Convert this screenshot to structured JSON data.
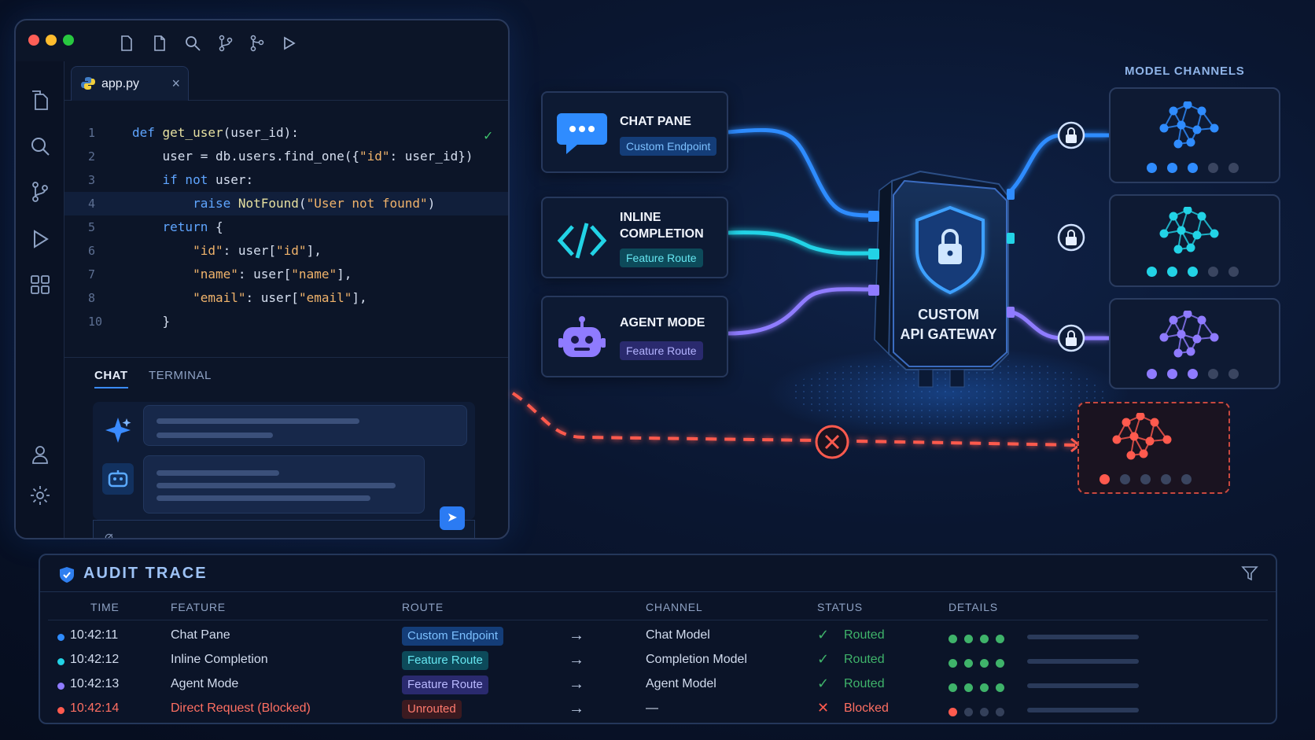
{
  "editor": {
    "tab": {
      "file_name": "app.py"
    },
    "lines": [
      {
        "num": "1",
        "parts": [
          [
            "k",
            "def "
          ],
          [
            "f",
            "get_user"
          ],
          [
            "n",
            "(user_id):"
          ]
        ]
      },
      {
        "num": "2",
        "parts": [
          [
            "n",
            "    user = db.users.find_one({"
          ],
          [
            "s",
            "\"id\""
          ],
          [
            "n",
            ": user_id})"
          ]
        ]
      },
      {
        "num": "3",
        "parts": [
          [
            "n",
            "    "
          ],
          [
            "k",
            "if not "
          ],
          [
            "n",
            "user:"
          ]
        ]
      },
      {
        "num": "4",
        "parts": [
          [
            "n",
            "        "
          ],
          [
            "k",
            "raise "
          ],
          [
            "f",
            "NotFound"
          ],
          [
            "n",
            "("
          ],
          [
            "s",
            "\"User not found\""
          ],
          [
            "n",
            ")"
          ]
        ]
      },
      {
        "num": "5",
        "parts": [
          [
            "n",
            "    "
          ],
          [
            "k",
            "return "
          ],
          [
            "n",
            "{"
          ]
        ]
      },
      {
        "num": "6",
        "parts": [
          [
            "n",
            "        "
          ],
          [
            "s",
            "\"id\""
          ],
          [
            "n",
            ": user["
          ],
          [
            "s",
            "\"id\""
          ],
          [
            "n",
            "],"
          ]
        ]
      },
      {
        "num": "7",
        "parts": [
          [
            "n",
            "        "
          ],
          [
            "s",
            "\"name\""
          ],
          [
            "n",
            ": user["
          ],
          [
            "s",
            "\"name\""
          ],
          [
            "n",
            "],"
          ]
        ]
      },
      {
        "num": "8",
        "parts": [
          [
            "n",
            "        "
          ],
          [
            "s",
            "\"email\""
          ],
          [
            "n",
            ": user["
          ],
          [
            "s",
            "\"email\""
          ],
          [
            "n",
            "],"
          ]
        ]
      },
      {
        "num": "10",
        "parts": [
          [
            "n",
            "    }"
          ]
        ]
      }
    ]
  },
  "panel": {
    "tabs": [
      {
        "label": "CHAT",
        "active": true
      },
      {
        "label": "TERMINAL",
        "active": false
      }
    ]
  },
  "features": [
    {
      "title": "CHAT PANE",
      "badge": "Custom Endpoint",
      "icon": "chat-bubble-icon",
      "color": "#2f8cff"
    },
    {
      "title": "INLINE\nCOMPLETION",
      "badge": "Feature Route",
      "icon": "code-brackets-icon",
      "color": "#22d3e6"
    },
    {
      "title": "AGENT MODE",
      "badge": "Feature Route",
      "icon": "robot-icon",
      "color": "#8f7bff"
    }
  ],
  "gateway": {
    "label_line1": "CUSTOM",
    "label_line2": "API GATEWAY"
  },
  "channels": {
    "title": "MODEL CHANNELS",
    "colors": [
      "#2f8cff",
      "#22d3e6",
      "#8f7bff",
      "#ff5a4e"
    ]
  },
  "audit": {
    "title": "AUDIT TRACE",
    "columns": [
      "TIME",
      "FEATURE",
      "ROUTE",
      "CHANNEL",
      "STATUS",
      "DETAILS"
    ],
    "rows": [
      {
        "time": "10:42:11",
        "feature": "Chat Pane",
        "route": "Custom Endpoint",
        "channel": "Chat Model",
        "status": "Routed",
        "bullet": "#2f8cff",
        "active_dots": 4
      },
      {
        "time": "10:42:12",
        "feature": "Inline Completion",
        "route": "Feature Route",
        "channel": "Completion Model",
        "status": "Routed",
        "bullet": "#22d3e6",
        "active_dots": 4
      },
      {
        "time": "10:42:13",
        "feature": "Agent Mode",
        "route": "Feature Route",
        "channel": "Agent Model",
        "status": "Routed",
        "bullet": "#8f7bff",
        "active_dots": 4
      },
      {
        "time": "10:42:14",
        "feature": "Direct Request (Blocked)",
        "route": "Unrouted",
        "channel": "—",
        "status": "Blocked",
        "bullet": "#ff5a4e",
        "active_dots": 1
      }
    ]
  }
}
